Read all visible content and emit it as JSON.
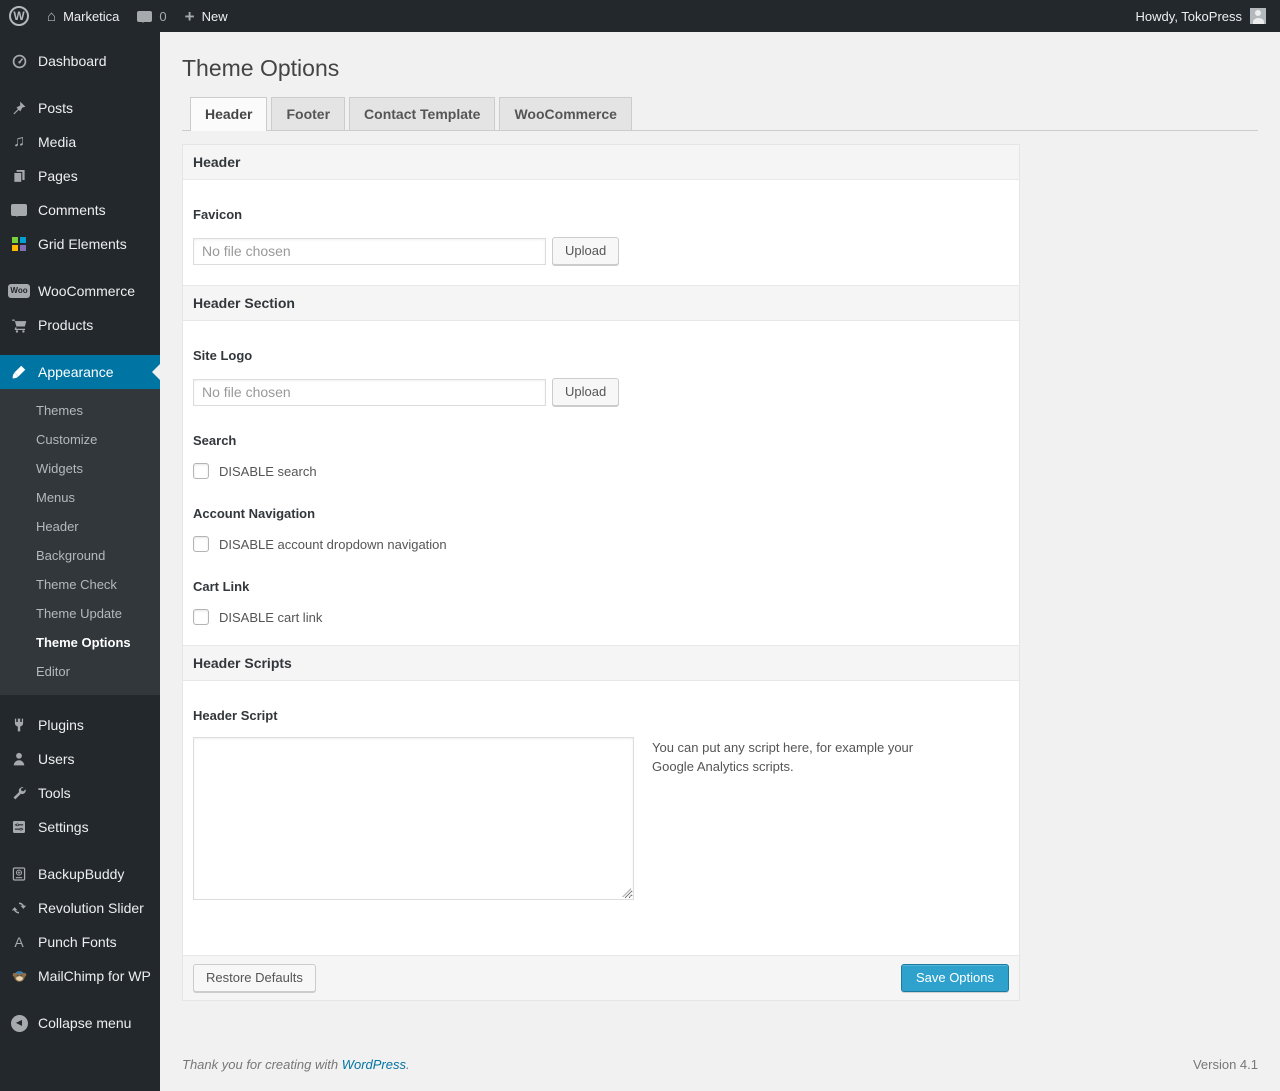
{
  "admin_bar": {
    "site_name": "Marketica",
    "comment_count": "0",
    "new_label": "New",
    "howdy": "Howdy, TokoPress"
  },
  "sidebar": {
    "items": [
      {
        "id": "dashboard",
        "label": "Dashboard",
        "icon": "dashboard"
      },
      {
        "id": "posts",
        "label": "Posts",
        "icon": "posts",
        "sep": true
      },
      {
        "id": "media",
        "label": "Media",
        "icon": "media"
      },
      {
        "id": "pages",
        "label": "Pages",
        "icon": "pages"
      },
      {
        "id": "comments",
        "label": "Comments",
        "icon": "comments"
      },
      {
        "id": "grid-elements",
        "label": "Grid Elements",
        "icon": "grid"
      },
      {
        "id": "woocommerce",
        "label": "WooCommerce",
        "icon": "woocommerce",
        "sep": true
      },
      {
        "id": "products",
        "label": "Products",
        "icon": "products"
      },
      {
        "id": "appearance",
        "label": "Appearance",
        "icon": "appearance",
        "sep": true,
        "current": true,
        "has_submenu": true
      },
      {
        "id": "plugins",
        "label": "Plugins",
        "icon": "plugins",
        "sep": true
      },
      {
        "id": "users",
        "label": "Users",
        "icon": "users"
      },
      {
        "id": "tools",
        "label": "Tools",
        "icon": "tools"
      },
      {
        "id": "settings",
        "label": "Settings",
        "icon": "settings"
      },
      {
        "id": "backupbuddy",
        "label": "BackupBuddy",
        "icon": "backupbuddy",
        "sep": true
      },
      {
        "id": "revolution-slider",
        "label": "Revolution Slider",
        "icon": "revslider"
      },
      {
        "id": "punch-fonts",
        "label": "Punch Fonts",
        "icon": "punchfonts"
      },
      {
        "id": "mailchimp-for-wp",
        "label": "MailChimp for WP",
        "icon": "mailchimp"
      },
      {
        "id": "collapse-menu",
        "label": "Collapse menu",
        "icon": "collapse",
        "sep": true
      }
    ],
    "appearance_submenu": [
      {
        "id": "themes",
        "label": "Themes"
      },
      {
        "id": "customize",
        "label": "Customize"
      },
      {
        "id": "widgets",
        "label": "Widgets"
      },
      {
        "id": "menus",
        "label": "Menus"
      },
      {
        "id": "header",
        "label": "Header"
      },
      {
        "id": "background",
        "label": "Background"
      },
      {
        "id": "theme-check",
        "label": "Theme Check"
      },
      {
        "id": "theme-update",
        "label": "Theme Update"
      },
      {
        "id": "theme-options",
        "label": "Theme Options",
        "current": true
      },
      {
        "id": "editor",
        "label": "Editor"
      }
    ]
  },
  "main": {
    "title": "Theme Options",
    "tabs": [
      {
        "id": "header",
        "label": "Header",
        "active": true
      },
      {
        "id": "footer",
        "label": "Footer",
        "active": false
      },
      {
        "id": "contact-template",
        "label": "Contact Template",
        "active": false
      },
      {
        "id": "woocommerce",
        "label": "WooCommerce",
        "active": false
      }
    ],
    "sections": [
      {
        "title": "Header",
        "fields": [
          {
            "label": "Favicon",
            "value": "No file chosen",
            "button": "Upload"
          }
        ]
      },
      {
        "title": "Header Section",
        "fields": [
          {
            "label": "Site Logo",
            "value": "No file chosen",
            "button": "Upload"
          },
          {
            "label": "Search",
            "checkbox_label": "DISABLE search",
            "checked": false
          },
          {
            "label": "Account Navigation",
            "checkbox_label": "DISABLE account dropdown navigation",
            "checked": false
          },
          {
            "label": "Cart Link",
            "checkbox_label": "DISABLE cart link",
            "checked": false
          }
        ]
      },
      {
        "title": "Header Scripts",
        "fields": [
          {
            "label": "Header Script",
            "textarea_value": "",
            "hint": "You can put any script here, for example your Google Analytics scripts."
          }
        ]
      }
    ],
    "footer": {
      "restore_label": "Restore Defaults",
      "save_label": "Save Options"
    }
  },
  "page_footer": {
    "thanks_prefix": "Thank you for creating with ",
    "link_text": "WordPress",
    "suffix": ".",
    "version": "Version 4.1"
  },
  "colors": {
    "admin_bar_bg": "#23282d",
    "submenu_bg": "#32373c",
    "highlight_accent": "#0074a2",
    "primary_button": "#2ea2cc",
    "content_bg": "#f1f1f1"
  }
}
